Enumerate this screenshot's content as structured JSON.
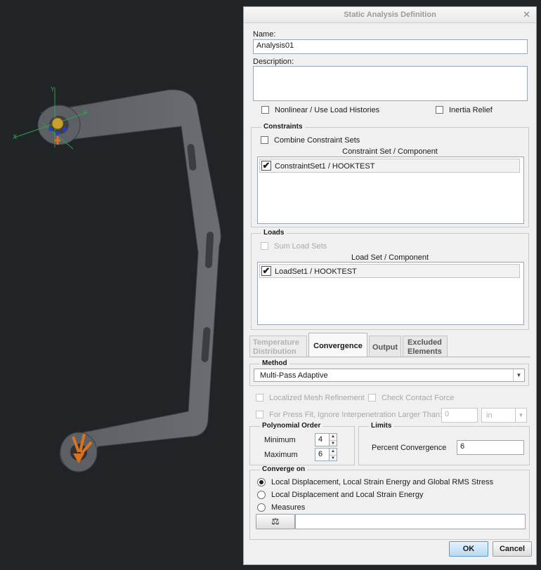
{
  "dialog": {
    "title": "Static Analysis Definition",
    "name_label": "Name:",
    "name_value": "Analysis01",
    "description_label": "Description:",
    "description_value": "",
    "nonlinear_label": "Nonlinear / Use Load Histories",
    "inertia_label": "Inertia Relief"
  },
  "constraints": {
    "legend": "Constraints",
    "combine_label": "Combine Constraint Sets",
    "column_header": "Constraint Set / Component",
    "items": [
      {
        "label": "ConstraintSet1 / HOOKTEST",
        "checked": true
      }
    ]
  },
  "loads": {
    "legend": "Loads",
    "sum_label": "Sum Load Sets",
    "column_header": "Load Set / Component",
    "items": [
      {
        "label": "LoadSet1 / HOOKTEST",
        "checked": true
      }
    ]
  },
  "tabs": {
    "temperature_line1": "Temperature",
    "temperature_line2": "Distribution",
    "convergence": "Convergence",
    "output": "Output",
    "excluded_line1": "Excluded",
    "excluded_line2": "Elements"
  },
  "method": {
    "legend": "Method",
    "selected": "Multi-Pass Adaptive"
  },
  "options": {
    "localized_mesh": "Localized Mesh Refinement",
    "check_contact": "Check Contact Force",
    "press_fit": "For Press Fit, Ignore Interpenetration Larger Than:",
    "press_fit_value": "0",
    "press_fit_unit": "in"
  },
  "polynomial": {
    "legend": "Polynomial Order",
    "minimum_label": "Minimum",
    "minimum_value": "4",
    "maximum_label": "Maximum",
    "maximum_value": "6"
  },
  "limits": {
    "legend": "Limits",
    "percent_label": "Percent Convergence",
    "percent_value": "6"
  },
  "converge": {
    "legend": "Converge on",
    "option1": "Local Displacement, Local Strain Energy and Global RMS Stress",
    "option2": "Local Displacement and Local Strain Energy",
    "option3": "Measures",
    "measures_value": ""
  },
  "buttons": {
    "ok": "OK",
    "cancel": "Cancel"
  }
}
